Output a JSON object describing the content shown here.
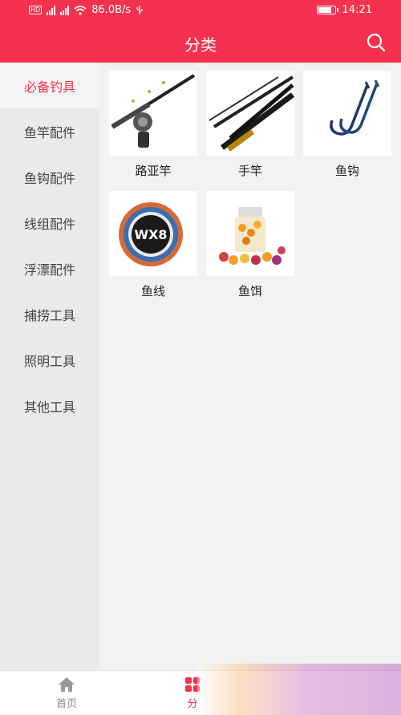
{
  "status": {
    "network": "86.0B/s",
    "time": "14:21",
    "battery_level": 0.85
  },
  "header": {
    "title": "分类"
  },
  "sidebar": {
    "items": [
      {
        "label": "必备钓具",
        "active": true
      },
      {
        "label": "鱼竿配件"
      },
      {
        "label": "鱼钩配件"
      },
      {
        "label": "线组配件"
      },
      {
        "label": "浮漂配件"
      },
      {
        "label": "捕捞工具"
      },
      {
        "label": "照明工具"
      },
      {
        "label": "其他工具"
      }
    ]
  },
  "products": [
    {
      "label": "路亚竿",
      "icon": "lure-rod-image"
    },
    {
      "label": "手竿",
      "icon": "hand-rod-image"
    },
    {
      "label": "鱼钩",
      "icon": "fish-hook-image"
    },
    {
      "label": "鱼线",
      "icon": "fishing-line-image"
    },
    {
      "label": "鱼饵",
      "icon": "fish-bait-image"
    }
  ],
  "tabbar": {
    "home": "首页",
    "category": "分"
  },
  "colors": {
    "accent": "#f4324f",
    "sidebar_bg": "#eaeaea",
    "content_bg": "#f2f2f2"
  }
}
